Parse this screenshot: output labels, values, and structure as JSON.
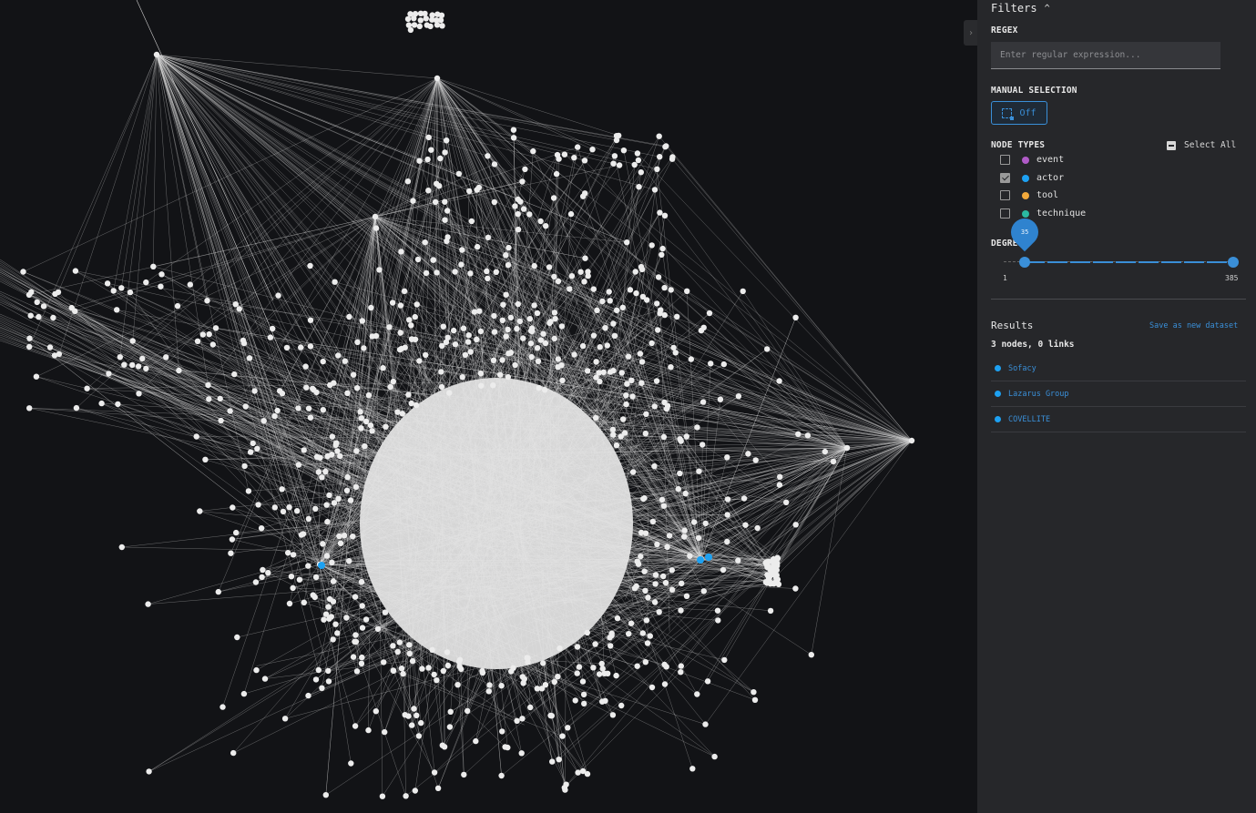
{
  "panel": {
    "title": "Filters",
    "regex": {
      "label": "REGEX",
      "placeholder": "Enter regular expression..."
    },
    "manual_selection": {
      "label": "MANUAL SELECTION",
      "toggle_label": "Off"
    },
    "node_types": {
      "label": "NODE TYPES",
      "select_all_label": "Select All",
      "items": [
        {
          "label": "event",
          "color": "#b05bc7",
          "checked": false
        },
        {
          "label": "actor",
          "color": "#1da1f2",
          "checked": true
        },
        {
          "label": "tool",
          "color": "#f2a93b",
          "checked": false
        },
        {
          "label": "technique",
          "color": "#2bb8a1",
          "checked": false
        }
      ]
    },
    "degree": {
      "label": "DEGREE",
      "min": "1",
      "max": "385",
      "value": "35",
      "min_value": 1,
      "max_value": 385,
      "current": 35
    },
    "results": {
      "title": "Results",
      "save_label": "Save as new dataset",
      "count_text": "3 nodes, 0 links",
      "items": [
        {
          "label": "Sofacy",
          "color": "#1da1f2"
        },
        {
          "label": "Lazarus Group",
          "color": "#1da1f2"
        },
        {
          "label": "COVELLITE",
          "color": "#1da1f2"
        }
      ]
    }
  },
  "colors": {
    "background": "#121316",
    "panel": "#26272a",
    "accent": "#3a8fd8",
    "node": "#ececec",
    "highlight": "#1da1f2"
  }
}
